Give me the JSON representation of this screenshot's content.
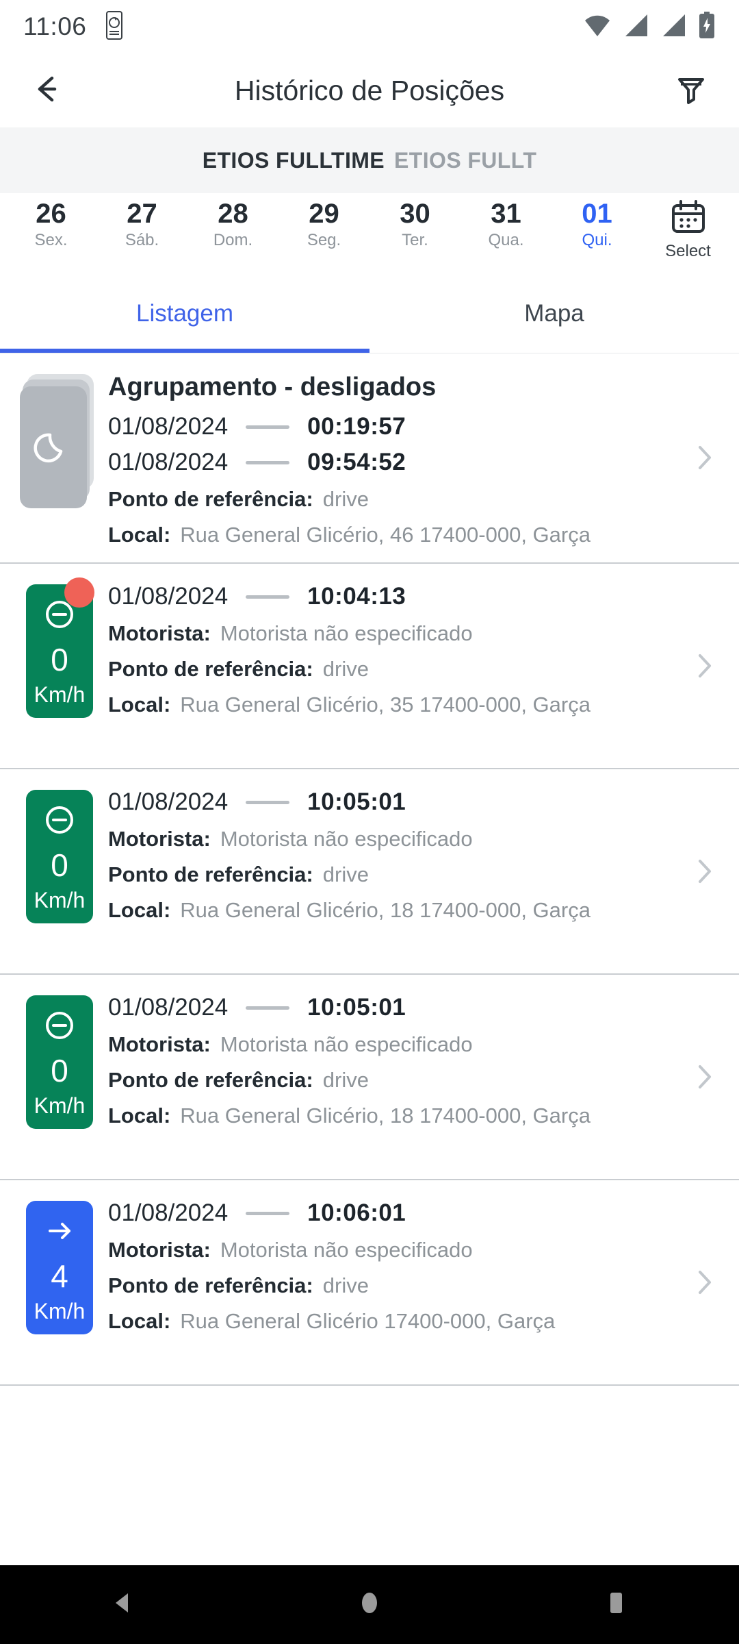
{
  "statusbar": {
    "time": "11:06",
    "icons": [
      "screen-record-icon",
      "wifi-icon",
      "signal-1-icon",
      "signal-2-icon",
      "battery-charging-icon"
    ]
  },
  "appbar": {
    "back_icon": "arrow-left-icon",
    "title": "Histórico de Posições",
    "filter_icon": "filter-icon"
  },
  "vehicle": {
    "primary": "ETIOS FULLTIME",
    "secondary": "ETIOS FULLT"
  },
  "dates": {
    "items": [
      {
        "day": "26",
        "dow": "Sex.",
        "selected": false
      },
      {
        "day": "27",
        "dow": "Sáb.",
        "selected": false
      },
      {
        "day": "28",
        "dow": "Dom.",
        "selected": false
      },
      {
        "day": "29",
        "dow": "Seg.",
        "selected": false
      },
      {
        "day": "30",
        "dow": "Ter.",
        "selected": false
      },
      {
        "day": "31",
        "dow": "Qua.",
        "selected": false
      },
      {
        "day": "01",
        "dow": "Qui.",
        "selected": true
      }
    ],
    "picker": {
      "icon": "calendar-icon",
      "label": "Select"
    },
    "selected_color": "#2f62f3"
  },
  "tabs": {
    "items": [
      {
        "label": "Listagem",
        "active": true
      },
      {
        "label": "Mapa",
        "active": false
      }
    ],
    "accent": "#3f63e8"
  },
  "labels": {
    "motorista": "Motorista:",
    "ponto": "Ponto de referência:",
    "local": "Local:"
  },
  "list": {
    "items": [
      {
        "kind": "group",
        "icon": "moon-icon",
        "title": "Agrupamento - desligados",
        "start_date": "01/08/2024",
        "start_time": "00:19:57",
        "end_date": "01/08/2024",
        "end_time": "09:54:52",
        "ponto_value": "drive",
        "local_value": "Rua General Glicério, 46 17400-000, Garça",
        "chevron": "chevron-right-icon"
      },
      {
        "kind": "speed",
        "badge_color": "#068358",
        "badge_icon": "circle-minus-icon",
        "speed": "0",
        "unit": "Km/h",
        "alert": true,
        "alert_color": "#ef6257",
        "date": "01/08/2024",
        "time": "10:04:13",
        "motorista_value": "Motorista não especificado",
        "ponto_value": "drive",
        "local_value": "Rua General Glicério, 35 17400-000, Garça",
        "chevron": "chevron-right-icon"
      },
      {
        "kind": "speed",
        "badge_color": "#068358",
        "badge_icon": "circle-minus-icon",
        "speed": "0",
        "unit": "Km/h",
        "alert": false,
        "date": "01/08/2024",
        "time": "10:05:01",
        "motorista_value": "Motorista não especificado",
        "ponto_value": "drive",
        "local_value": "Rua General Glicério, 18 17400-000, Garça",
        "chevron": "chevron-right-icon"
      },
      {
        "kind": "speed",
        "badge_color": "#068358",
        "badge_icon": "circle-minus-icon",
        "speed": "0",
        "unit": "Km/h",
        "alert": false,
        "date": "01/08/2024",
        "time": "10:05:01",
        "motorista_value": "Motorista não especificado",
        "ponto_value": "drive",
        "local_value": "Rua General Glicério, 18 17400-000, Garça",
        "chevron": "chevron-right-icon"
      },
      {
        "kind": "speed",
        "badge_color": "#3064f0",
        "badge_icon": "arrow-right-icon",
        "speed": "4",
        "unit": "Km/h",
        "alert": false,
        "date": "01/08/2024",
        "time": "10:06:01",
        "motorista_value": "Motorista não especificado",
        "ponto_value": "drive",
        "local_value": "Rua General Glicério 17400-000, Garça",
        "chevron": "chevron-right-icon"
      }
    ]
  },
  "navbar": {
    "back": "nav-back-icon",
    "home": "nav-home-icon",
    "recents": "nav-recents-icon"
  }
}
